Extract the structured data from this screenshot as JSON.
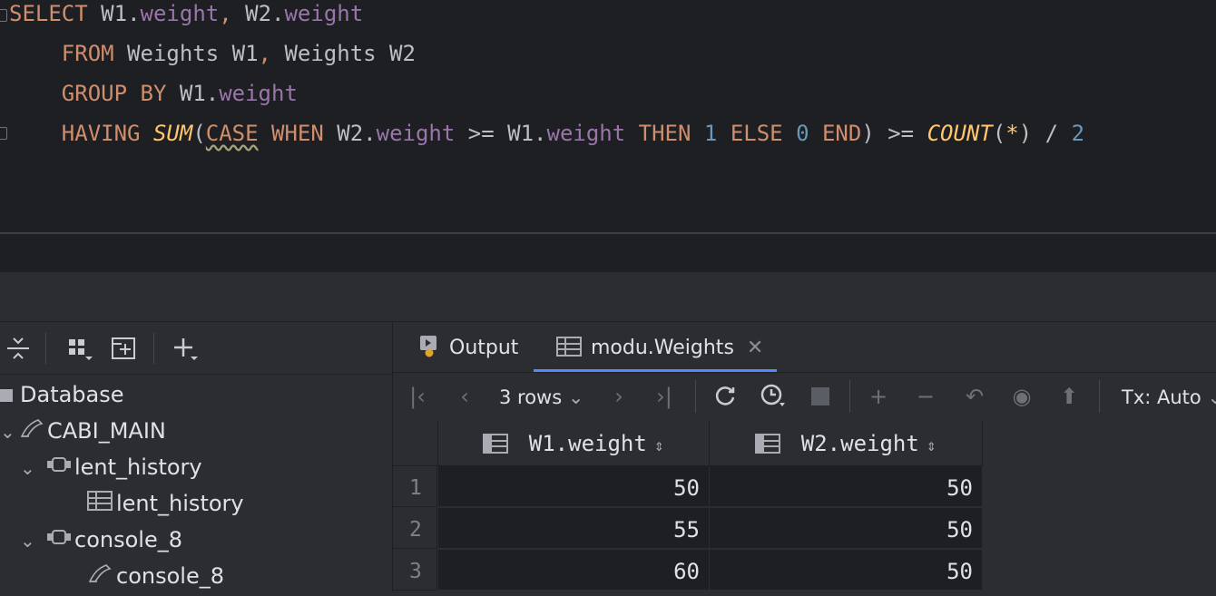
{
  "editor": {
    "line1": {
      "kw": "SELECT",
      "a": "W1",
      "dot1": ".",
      "b": "weight",
      "comma": ",",
      "c": "W2",
      "dot2": ".",
      "d": "weight"
    },
    "line2": {
      "kw": "FROM",
      "t1": "Weights W1",
      "comma": ",",
      "t2": "Weights W2"
    },
    "line3": {
      "kw": "GROUP BY",
      "a": "W1",
      "dot": ".",
      "b": "weight"
    },
    "line4": {
      "kw": "HAVING",
      "fn1": "SUM",
      "p1": "(",
      "case": "CASE",
      "when": "WHEN",
      "a": "W2",
      "dot1": ".",
      "b": "weight",
      "op1": ">=",
      "c": "W1",
      "dot2": ".",
      "d": "weight",
      "then": "THEN",
      "n1": "1",
      "else": "ELSE",
      "n0": "0",
      "end": "END",
      "p2": ")",
      "op2": ">=",
      "fn2": "COUNT",
      "p3": "(",
      "star": "*",
      "p4": ")",
      "div": "/",
      "n2": "2"
    }
  },
  "left_panel": {
    "tree": {
      "root": "Database",
      "datasource": "CABI_MAIN",
      "session1": "lent_history",
      "session1_child": "lent_history",
      "session2": "console_8",
      "session2_child": "console_8"
    }
  },
  "results": {
    "tabs": [
      {
        "label": "Output"
      },
      {
        "label": "modu.Weights"
      }
    ],
    "rows_label": "3 rows",
    "tx_label": "Tx: Auto",
    "columns": [
      "W1.weight",
      "W2.weight"
    ],
    "rows": [
      {
        "num": "1",
        "w1": "50",
        "w2": "50"
      },
      {
        "num": "2",
        "w1": "55",
        "w2": "50"
      },
      {
        "num": "3",
        "w1": "60",
        "w2": "50"
      }
    ]
  }
}
